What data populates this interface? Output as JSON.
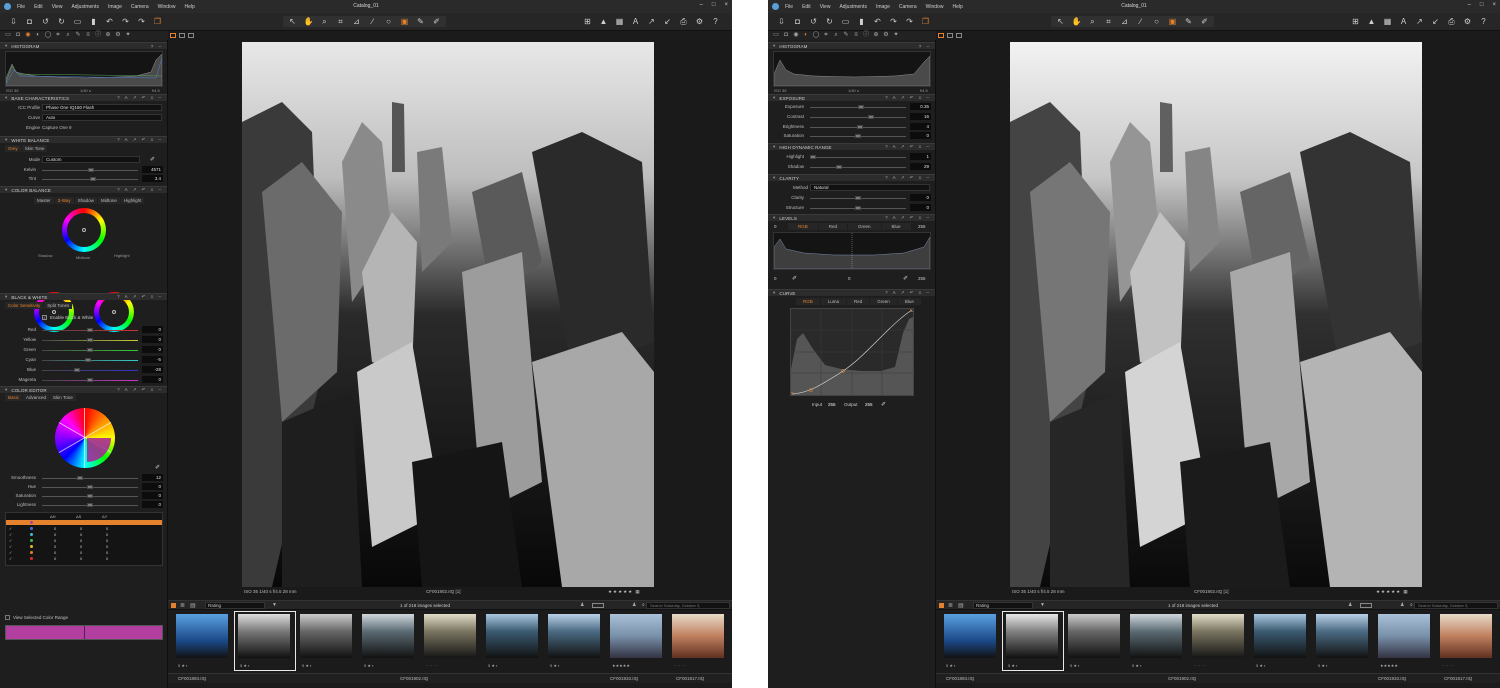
{
  "window": {
    "title": "Catalog_01",
    "menu": [
      "File",
      "Edit",
      "View",
      "Adjustments",
      "Image",
      "Camera",
      "Window",
      "Help"
    ]
  },
  "colors": {
    "accent": "#e5822d",
    "panel_bg": "#1e1e1e",
    "header_bg": "#2c2c2c",
    "magenta_swatch": "#b23fa0"
  },
  "left": {
    "histogram": {
      "title": "HISTOGRAM",
      "iso": "ISO 35",
      "shutter": "1/40 s",
      "aperture": "f/4.5"
    },
    "base": {
      "title": "BASE CHARACTERISTICS",
      "icc_label": "ICC Profile",
      "icc_value": "Phase One IQ180 Flash",
      "curve_label": "Curve",
      "curve_value": "Auto",
      "engine_label": "Engine",
      "engine_value": "Capture One 9"
    },
    "wb": {
      "title": "WHITE BALANCE",
      "tabs": [
        "Grey",
        "Skin Tone"
      ],
      "mode_label": "Mode",
      "mode_value": "Custom",
      "kelvin_label": "Kelvin",
      "kelvin_value": "4571",
      "tint_label": "Tint",
      "tint_value": "3.4"
    },
    "cb": {
      "title": "COLOR BALANCE",
      "tabs": [
        "Master",
        "3-Way",
        "Shadow",
        "Midtone",
        "Highlight"
      ],
      "shadow": "Shadow",
      "midtone": "Midtone",
      "highlight": "Highlight"
    },
    "bw": {
      "title": "BLACK & WHITE",
      "tabs": [
        "Color Sensitivity",
        "Split Tones"
      ],
      "enable": "Enable Black & White",
      "rows": [
        {
          "label": "Red",
          "value": "0"
        },
        {
          "label": "Yellow",
          "value": "0"
        },
        {
          "label": "Green",
          "value": "0"
        },
        {
          "label": "Cyan",
          "value": "-5"
        },
        {
          "label": "Blue",
          "value": "-28"
        },
        {
          "label": "Magenta",
          "value": "0"
        }
      ]
    },
    "ce": {
      "title": "COLOR EDITOR",
      "tabs": [
        "Basic",
        "Advanced",
        "Skin Tone"
      ],
      "rows": [
        {
          "label": "Smoothness",
          "value": "12"
        },
        {
          "label": "Hue",
          "value": "0"
        },
        {
          "label": "Saturation",
          "value": "0"
        },
        {
          "label": "Lightness",
          "value": "0"
        }
      ],
      "table_headers": [
        "ΔH",
        "ΔS",
        "ΔY"
      ],
      "zero": "0",
      "view_selected": "View Selected Color Range"
    }
  },
  "right": {
    "histogram": {
      "title": "HISTOGRAM",
      "iso": "ISO 35",
      "shutter": "1/40 s",
      "aperture": "f/4.5"
    },
    "exposure": {
      "title": "EXPOSURE",
      "rows": [
        {
          "label": "Exposure",
          "value": "0.35"
        },
        {
          "label": "Contrast",
          "value": "16"
        },
        {
          "label": "Brightness",
          "value": "4"
        },
        {
          "label": "Saturation",
          "value": "0"
        }
      ]
    },
    "hdr": {
      "title": "HIGH DYNAMIC RANGE",
      "rows": [
        {
          "label": "Highlight",
          "value": "1"
        },
        {
          "label": "Shadow",
          "value": "29"
        }
      ]
    },
    "clarity": {
      "title": "CLARITY",
      "method_label": "Method",
      "method_value": "Natural",
      "rows": [
        {
          "label": "Clarity",
          "value": "0"
        },
        {
          "label": "Structure",
          "value": "0"
        }
      ]
    },
    "levels": {
      "title": "LEVELS",
      "tabs": [
        "RGB",
        "Red",
        "Green",
        "Blue"
      ],
      "in_low": "0",
      "in_high": "255",
      "out_low": "0",
      "mid": "0",
      "out_high": "255"
    },
    "curve": {
      "title": "CURVE",
      "tabs": [
        "RGB",
        "Luma",
        "Red",
        "Green",
        "Blue"
      ],
      "input_label": "Input",
      "input_value": "255",
      "output_label": "Output",
      "output_value": "255"
    }
  },
  "viewer": {
    "status": "ISO 35  1/40 s  f/4.5  28 mm",
    "filename": "CF001902.IIQ [1]",
    "zoom": "Fit"
  },
  "browser": {
    "sort_label": "Rating",
    "count": "1 of 219 images selected",
    "search_placeholder": "Search Saturday, October 3,",
    "filenames": [
      "CF001893.IIQ",
      "CF001902.IIQ",
      "CF001933.IIQ",
      "CF001817.IIQ"
    ]
  }
}
